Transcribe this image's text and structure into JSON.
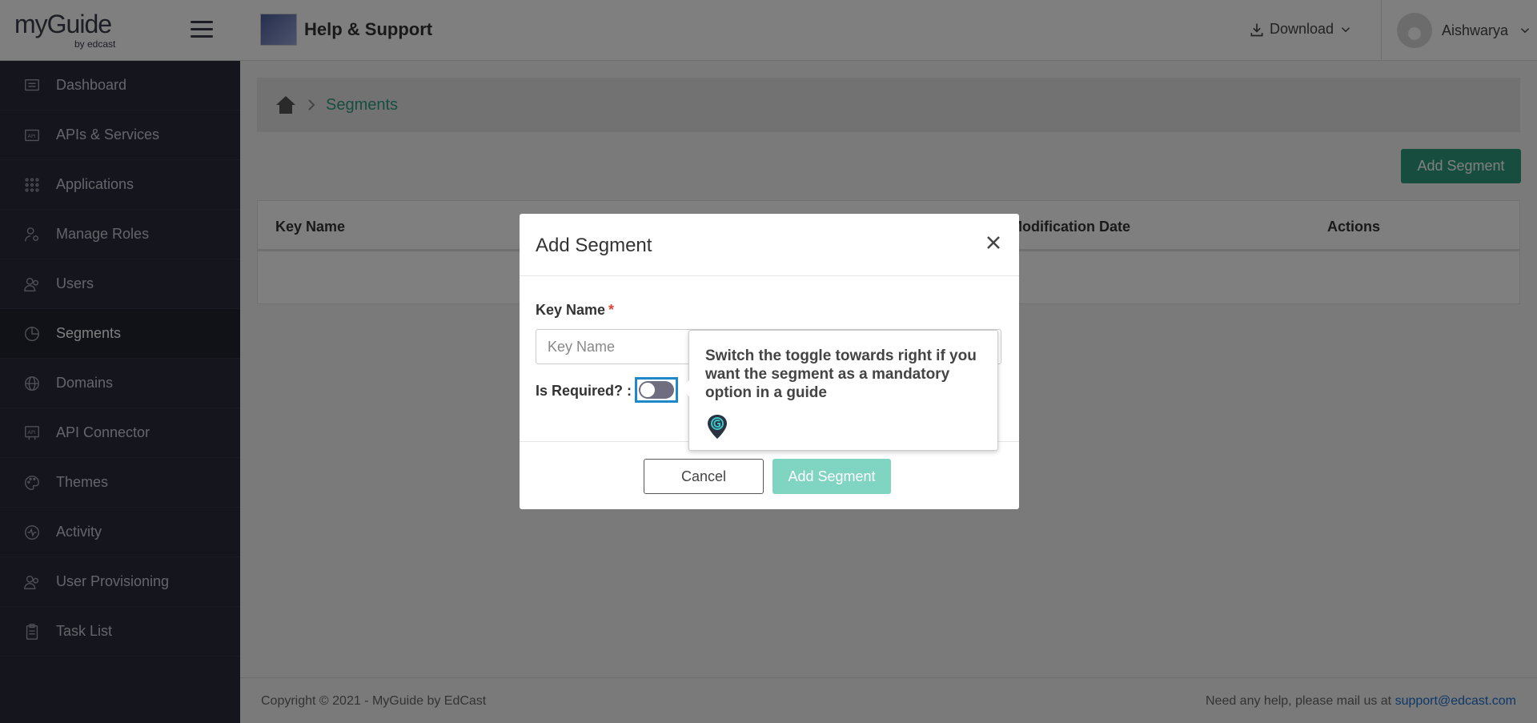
{
  "app": {
    "brand": "myGuide",
    "brand_sub": "by edcast"
  },
  "header": {
    "title": "Help & Support",
    "download_label": "Download",
    "user_name": "Aishwarya"
  },
  "sidebar": {
    "items": [
      {
        "label": "Dashboard",
        "icon": "dashboard-icon"
      },
      {
        "label": "APIs & Services",
        "icon": "api-icon"
      },
      {
        "label": "Applications",
        "icon": "grid-icon"
      },
      {
        "label": "Manage Roles",
        "icon": "user-key-icon"
      },
      {
        "label": "Users",
        "icon": "users-icon"
      },
      {
        "label": "Segments",
        "icon": "pie-chart-icon",
        "active": true
      },
      {
        "label": "Domains",
        "icon": "globe-icon"
      },
      {
        "label": "API Connector",
        "icon": "api-connector-icon"
      },
      {
        "label": "Themes",
        "icon": "palette-icon"
      },
      {
        "label": "Activity",
        "icon": "activity-icon"
      },
      {
        "label": "User Provisioning",
        "icon": "users-icon"
      },
      {
        "label": "Task List",
        "icon": "clipboard-icon"
      }
    ]
  },
  "breadcrumb": {
    "current": "Segments"
  },
  "main": {
    "add_button": "Add Segment",
    "columns": [
      "Key Name",
      "Modification Date",
      "Actions"
    ]
  },
  "footer": {
    "copyright": "Copyright © 2021 - MyGuide by EdCast",
    "help_text": "Need any help, please mail us at",
    "help_email": "support@edcast.com"
  },
  "modal": {
    "title": "Add Segment",
    "key_label": "Key Name",
    "required_mark": "*",
    "key_placeholder": "Key Name",
    "required_label": "Is Required? :",
    "toggle_on": false,
    "cancel_label": "Cancel",
    "submit_label": "Add Segment"
  },
  "tooltip": {
    "text": "Switch the toggle towards right if you want the segment as a mandatory option in a guide"
  },
  "colors": {
    "accent": "#2e9b7e",
    "sidebar_bg": "#2a2d3a",
    "toggle_focus": "#1e88c8",
    "link": "#1b6fd0"
  }
}
